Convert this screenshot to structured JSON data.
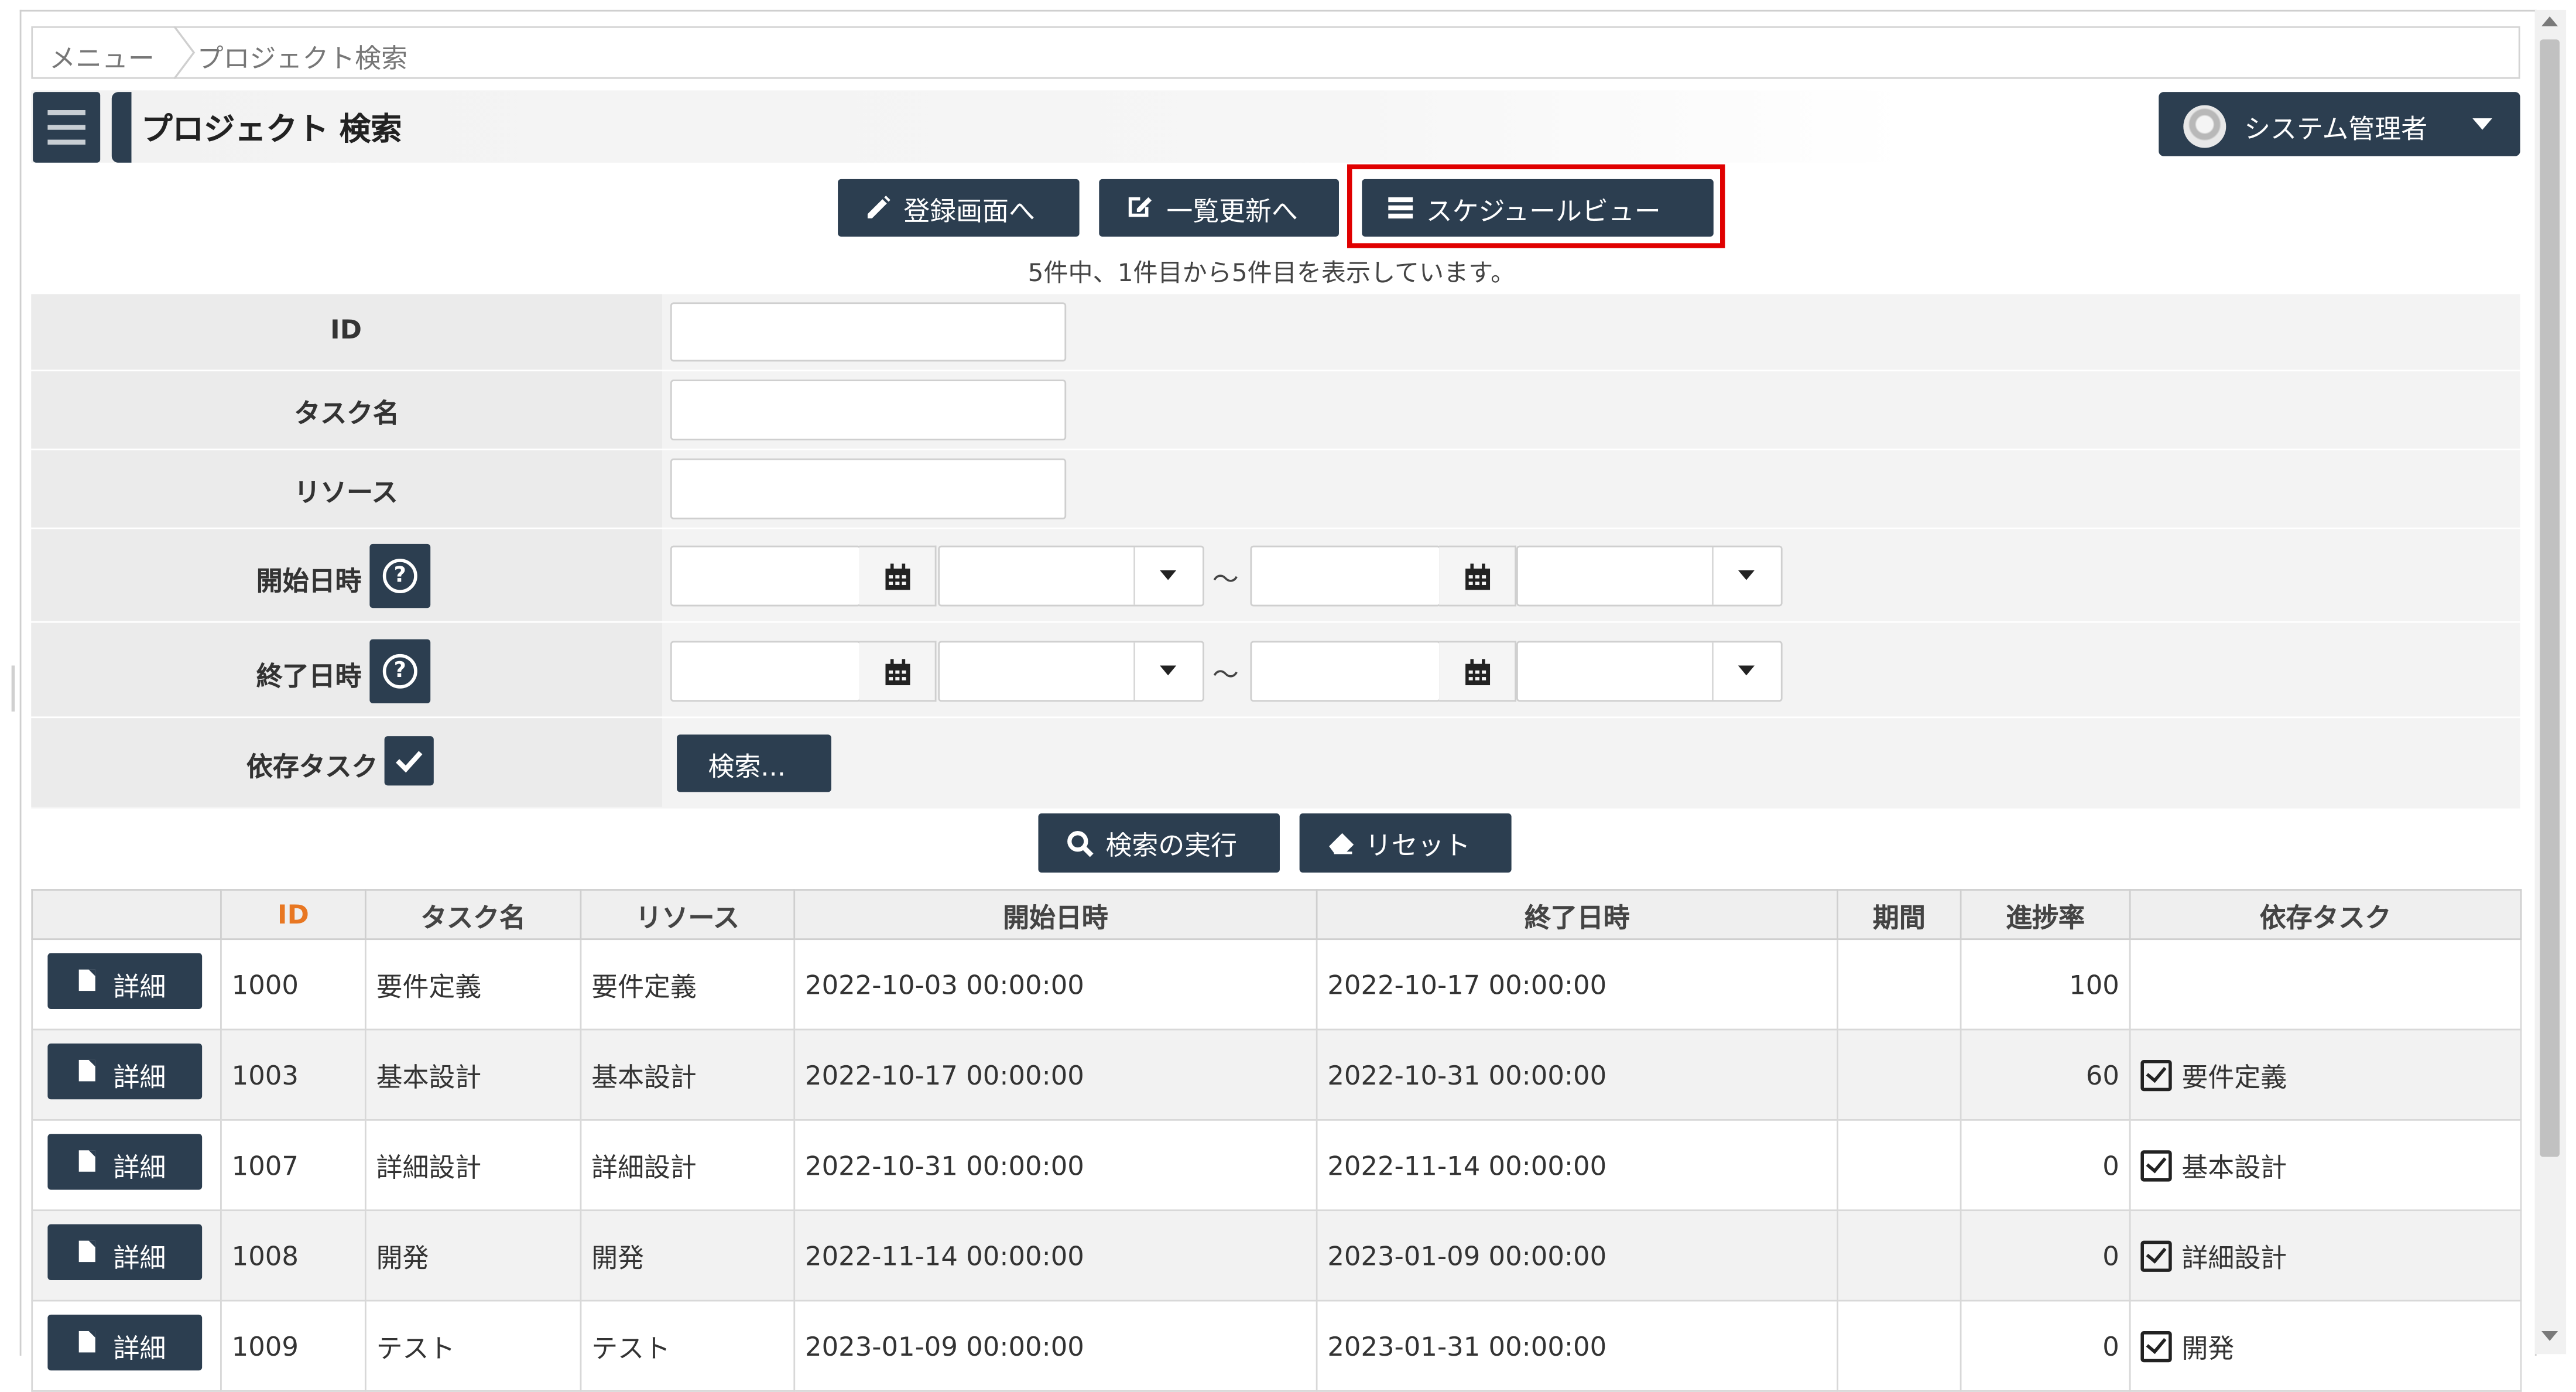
{
  "breadcrumb": {
    "menu": "メニュー",
    "current": "プロジェクト検索"
  },
  "header": {
    "title": "プロジェクト 検索",
    "user": "システム管理者"
  },
  "toolbar": {
    "register": "登録画面へ",
    "bulk_update": "一覧更新へ",
    "schedule_view": "スケジュールビュー"
  },
  "result_count": "5件中、1件目から5件目を表示しています。",
  "search_form": {
    "id_label": "ID",
    "task_name_label": "タスク名",
    "resource_label": "リソース",
    "start_label": "開始日時",
    "end_label": "終了日時",
    "dependency_label": "依存タスク",
    "range_sep": "～",
    "dependency_button": "検索...",
    "help_glyph": "?"
  },
  "actions": {
    "search": "検索の実行",
    "reset": "リセット"
  },
  "table": {
    "columns": [
      "",
      "ID",
      "タスク名",
      "リソース",
      "開始日時",
      "終了日時",
      "期間",
      "進捗率",
      "依存タスク"
    ],
    "detail_label": "詳細",
    "rows": [
      {
        "id": "1000",
        "task": "要件定義",
        "resource": "要件定義",
        "start": "2022-10-03 00:00:00",
        "end": "2022-10-17 00:00:00",
        "duration": "",
        "progress": "100",
        "dependency": ""
      },
      {
        "id": "1003",
        "task": "基本設計",
        "resource": "基本設計",
        "start": "2022-10-17 00:00:00",
        "end": "2022-10-31 00:00:00",
        "duration": "",
        "progress": "60",
        "dependency": "要件定義"
      },
      {
        "id": "1007",
        "task": "詳細設計",
        "resource": "詳細設計",
        "start": "2022-10-31 00:00:00",
        "end": "2022-11-14 00:00:00",
        "duration": "",
        "progress": "0",
        "dependency": "基本設計"
      },
      {
        "id": "1008",
        "task": "開発",
        "resource": "開発",
        "start": "2022-11-14 00:00:00",
        "end": "2023-01-09 00:00:00",
        "duration": "",
        "progress": "0",
        "dependency": "詳細設計"
      },
      {
        "id": "1009",
        "task": "テスト",
        "resource": "テスト",
        "start": "2023-01-09 00:00:00",
        "end": "2023-01-31 00:00:00",
        "duration": "",
        "progress": "0",
        "dependency": "開発"
      }
    ]
  },
  "colors": {
    "primary": "#2c3e50",
    "highlight": "#e00000",
    "id_header": "#e87722"
  }
}
